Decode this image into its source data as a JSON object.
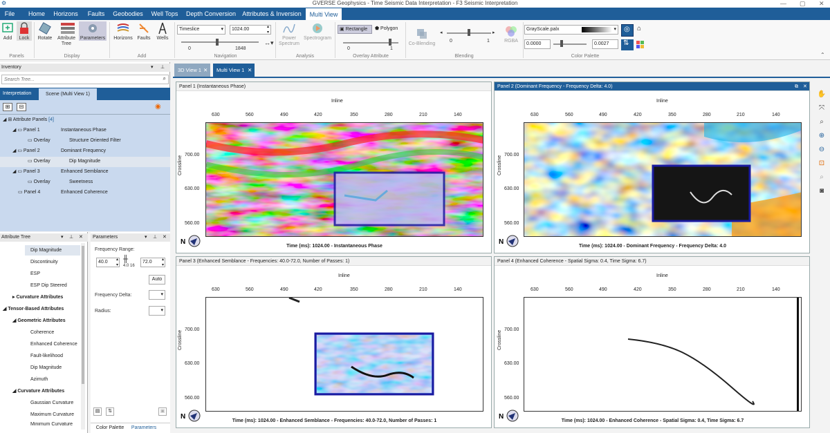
{
  "window": {
    "title": "GVERSE Geophysics - Time Seismic Data Interpretation - F3 Seismic Interpretation",
    "minimize": "—",
    "maximize": "▢",
    "close": "✕"
  },
  "menu": [
    "File",
    "Home",
    "Horizons",
    "Faults",
    "Geobodies",
    "Well Tops",
    "Depth Conversion",
    "Attributes & Inversion",
    "Multi View"
  ],
  "ribbon": {
    "panels": {
      "label": "Panels",
      "add": "Add",
      "lock": "Lock"
    },
    "display": {
      "label": "Display",
      "rotate": "Rotate",
      "attribute_tree": "Attribute Tree",
      "parameters": "Parameters"
    },
    "add": {
      "label": "Add",
      "horizons": "Horizons",
      "faults": "Faults",
      "wells": "Wells"
    },
    "navigation": {
      "label": "Navigation",
      "mode": "Timeslice",
      "value": "1024.00",
      "min": "0",
      "max": "1848"
    },
    "analysis": {
      "label": "Analysis",
      "power_spectrum": "Power Spectrum",
      "spectrogram": "Spectrogram"
    },
    "overlay": {
      "label": "Overlay Attribute",
      "rectangle": "Rectangle",
      "polygon": "Polygon",
      "min": "0",
      "max": "1"
    },
    "blending": {
      "label": "Blending",
      "co_blending": "Co-Blending",
      "min": "0",
      "max": "1",
      "rgba": "RGBA"
    },
    "color_palette": {
      "label": "Color Palette",
      "palette": "GrayScale.palx",
      "min": "0.0000",
      "max": "0.0027"
    }
  },
  "inventory": {
    "title": "Inventory",
    "search_placeholder": "Search Tree...",
    "tabs": [
      "Interpretation",
      "Scene (Multi View 1)"
    ],
    "tree": [
      {
        "label": "Attribute Panels",
        "count": "[4]"
      },
      {
        "panel": "Panel 1",
        "name": "Instantaneous Phase"
      },
      {
        "panel": "Overlay",
        "name": "Structure Oriented Filter"
      },
      {
        "panel": "Panel 2",
        "name": "Dominant Frequency"
      },
      {
        "panel": "Overlay",
        "name": "Dip Magnitude"
      },
      {
        "panel": "Panel 3",
        "name": "Enhanced Semblance"
      },
      {
        "panel": "Overlay",
        "name": "Sweetness"
      },
      {
        "panel": "Panel 4",
        "name": "Enhanced Coherence"
      }
    ]
  },
  "attribute_tree": {
    "title": "Attribute Tree",
    "items": [
      {
        "label": "Dip Magnitude",
        "kind": "leaf"
      },
      {
        "label": "Discontinuity",
        "kind": "leaf"
      },
      {
        "label": "ESP",
        "kind": "leaf"
      },
      {
        "label": "ESP Dip Steered",
        "kind": "leaf"
      },
      {
        "label": "Curvature Attributes",
        "kind": "group"
      },
      {
        "label": "Tensor-Based Attributes",
        "kind": "root"
      },
      {
        "label": "Geometric Attributes",
        "kind": "group"
      },
      {
        "label": "Coherence",
        "kind": "leaf"
      },
      {
        "label": "Enhanced Coherence",
        "kind": "leaf"
      },
      {
        "label": "Fault-likelihood",
        "kind": "leaf"
      },
      {
        "label": "Dip Magnitude",
        "kind": "leaf"
      },
      {
        "label": "Azimuth",
        "kind": "leaf"
      },
      {
        "label": "Curvature Attributes",
        "kind": "group"
      },
      {
        "label": "Gaussian Curvature",
        "kind": "leaf"
      },
      {
        "label": "Maximum Curvature",
        "kind": "leaf"
      },
      {
        "label": "Minimum Curvature",
        "kind": "leaf"
      }
    ]
  },
  "parameters": {
    "title": "Parameters",
    "frequency_range": "Frequency Range:",
    "freq_min": "40.0",
    "freq_max": "72.0",
    "freq_mid": "4.0 16",
    "auto": "Auto",
    "frequency_delta": "Frequency Delta:",
    "radius": "Radius:",
    "bottom_tabs": [
      "Color Palette",
      "Parameters"
    ]
  },
  "view_tabs": [
    "3D View 1",
    "Multi View 1"
  ],
  "axis": {
    "inline_label": "Inline",
    "crossline_label": "Crossline",
    "inline_ticks": [
      "630",
      "560",
      "490",
      "420",
      "350",
      "280",
      "210",
      "140"
    ],
    "crossline_ticks": [
      "700.00",
      "630.00",
      "560.00"
    ]
  },
  "panels": [
    {
      "header": "Panel 1 (Instantaneous Phase)",
      "caption": "Time (ms): 1024.00 - Instantaneous Phase"
    },
    {
      "header": "Panel 2 (Dominant Frequency - Frequency Delta: 4.0)",
      "caption": "Time (ms): 1024.00 - Dominant Frequency - Frequency Delta: 4.0"
    },
    {
      "header": "Panel 3 (Enhanced Semblance - Frequencies: 40.0-72.0, Number of Passes: 1)",
      "caption": "Time (ms): 1024.00 - Enhanced Semblance - Frequencies: 40.0-72.0, Number of Passes: 1"
    },
    {
      "header": "Panel 4 (Enhanced Coherence - Spatial Sigma: 0.4, Time Sigma: 6.7)",
      "caption": "Time (ms): 1024.00 - Enhanced Coherence - Spatial Sigma: 0.4, Time Sigma: 6.7"
    }
  ],
  "compass_label": "N"
}
